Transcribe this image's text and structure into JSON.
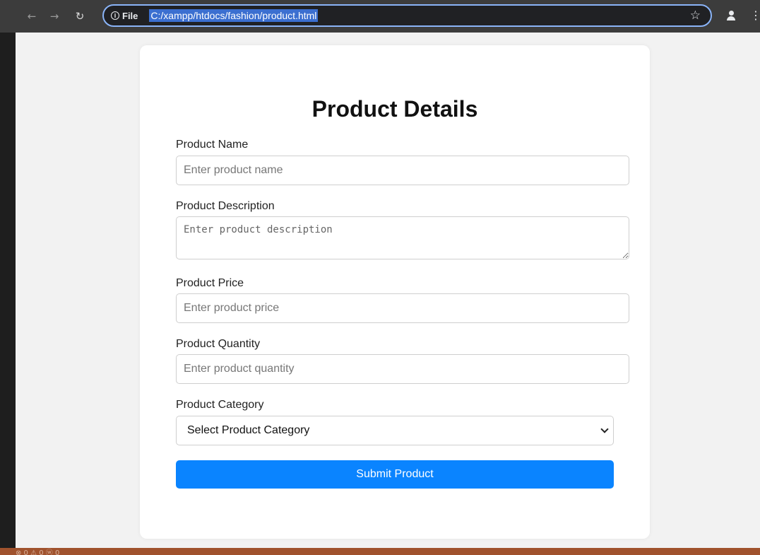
{
  "browser": {
    "site_info": "File",
    "url": "C:/xampp/htdocs/fashion/product.html"
  },
  "form": {
    "title": "Product Details",
    "fields": [
      {
        "label": "Product Name",
        "placeholder": "Enter product name"
      },
      {
        "label": "Product Description",
        "placeholder": "Enter product description"
      },
      {
        "label": "Product Price",
        "placeholder": "Enter product price"
      },
      {
        "label": "Product Quantity",
        "placeholder": "Enter product quantity"
      }
    ],
    "category": {
      "label": "Product Category",
      "selected": "Select Product Category"
    },
    "submit_label": "Submit Product"
  },
  "status_bar": {
    "text": "⊗ 0 ⚠ 0   ⓦ 0"
  },
  "colors": {
    "accent": "#0a84ff",
    "url_highlight": "#3b6fd0",
    "status_bar": "#a0522d"
  }
}
